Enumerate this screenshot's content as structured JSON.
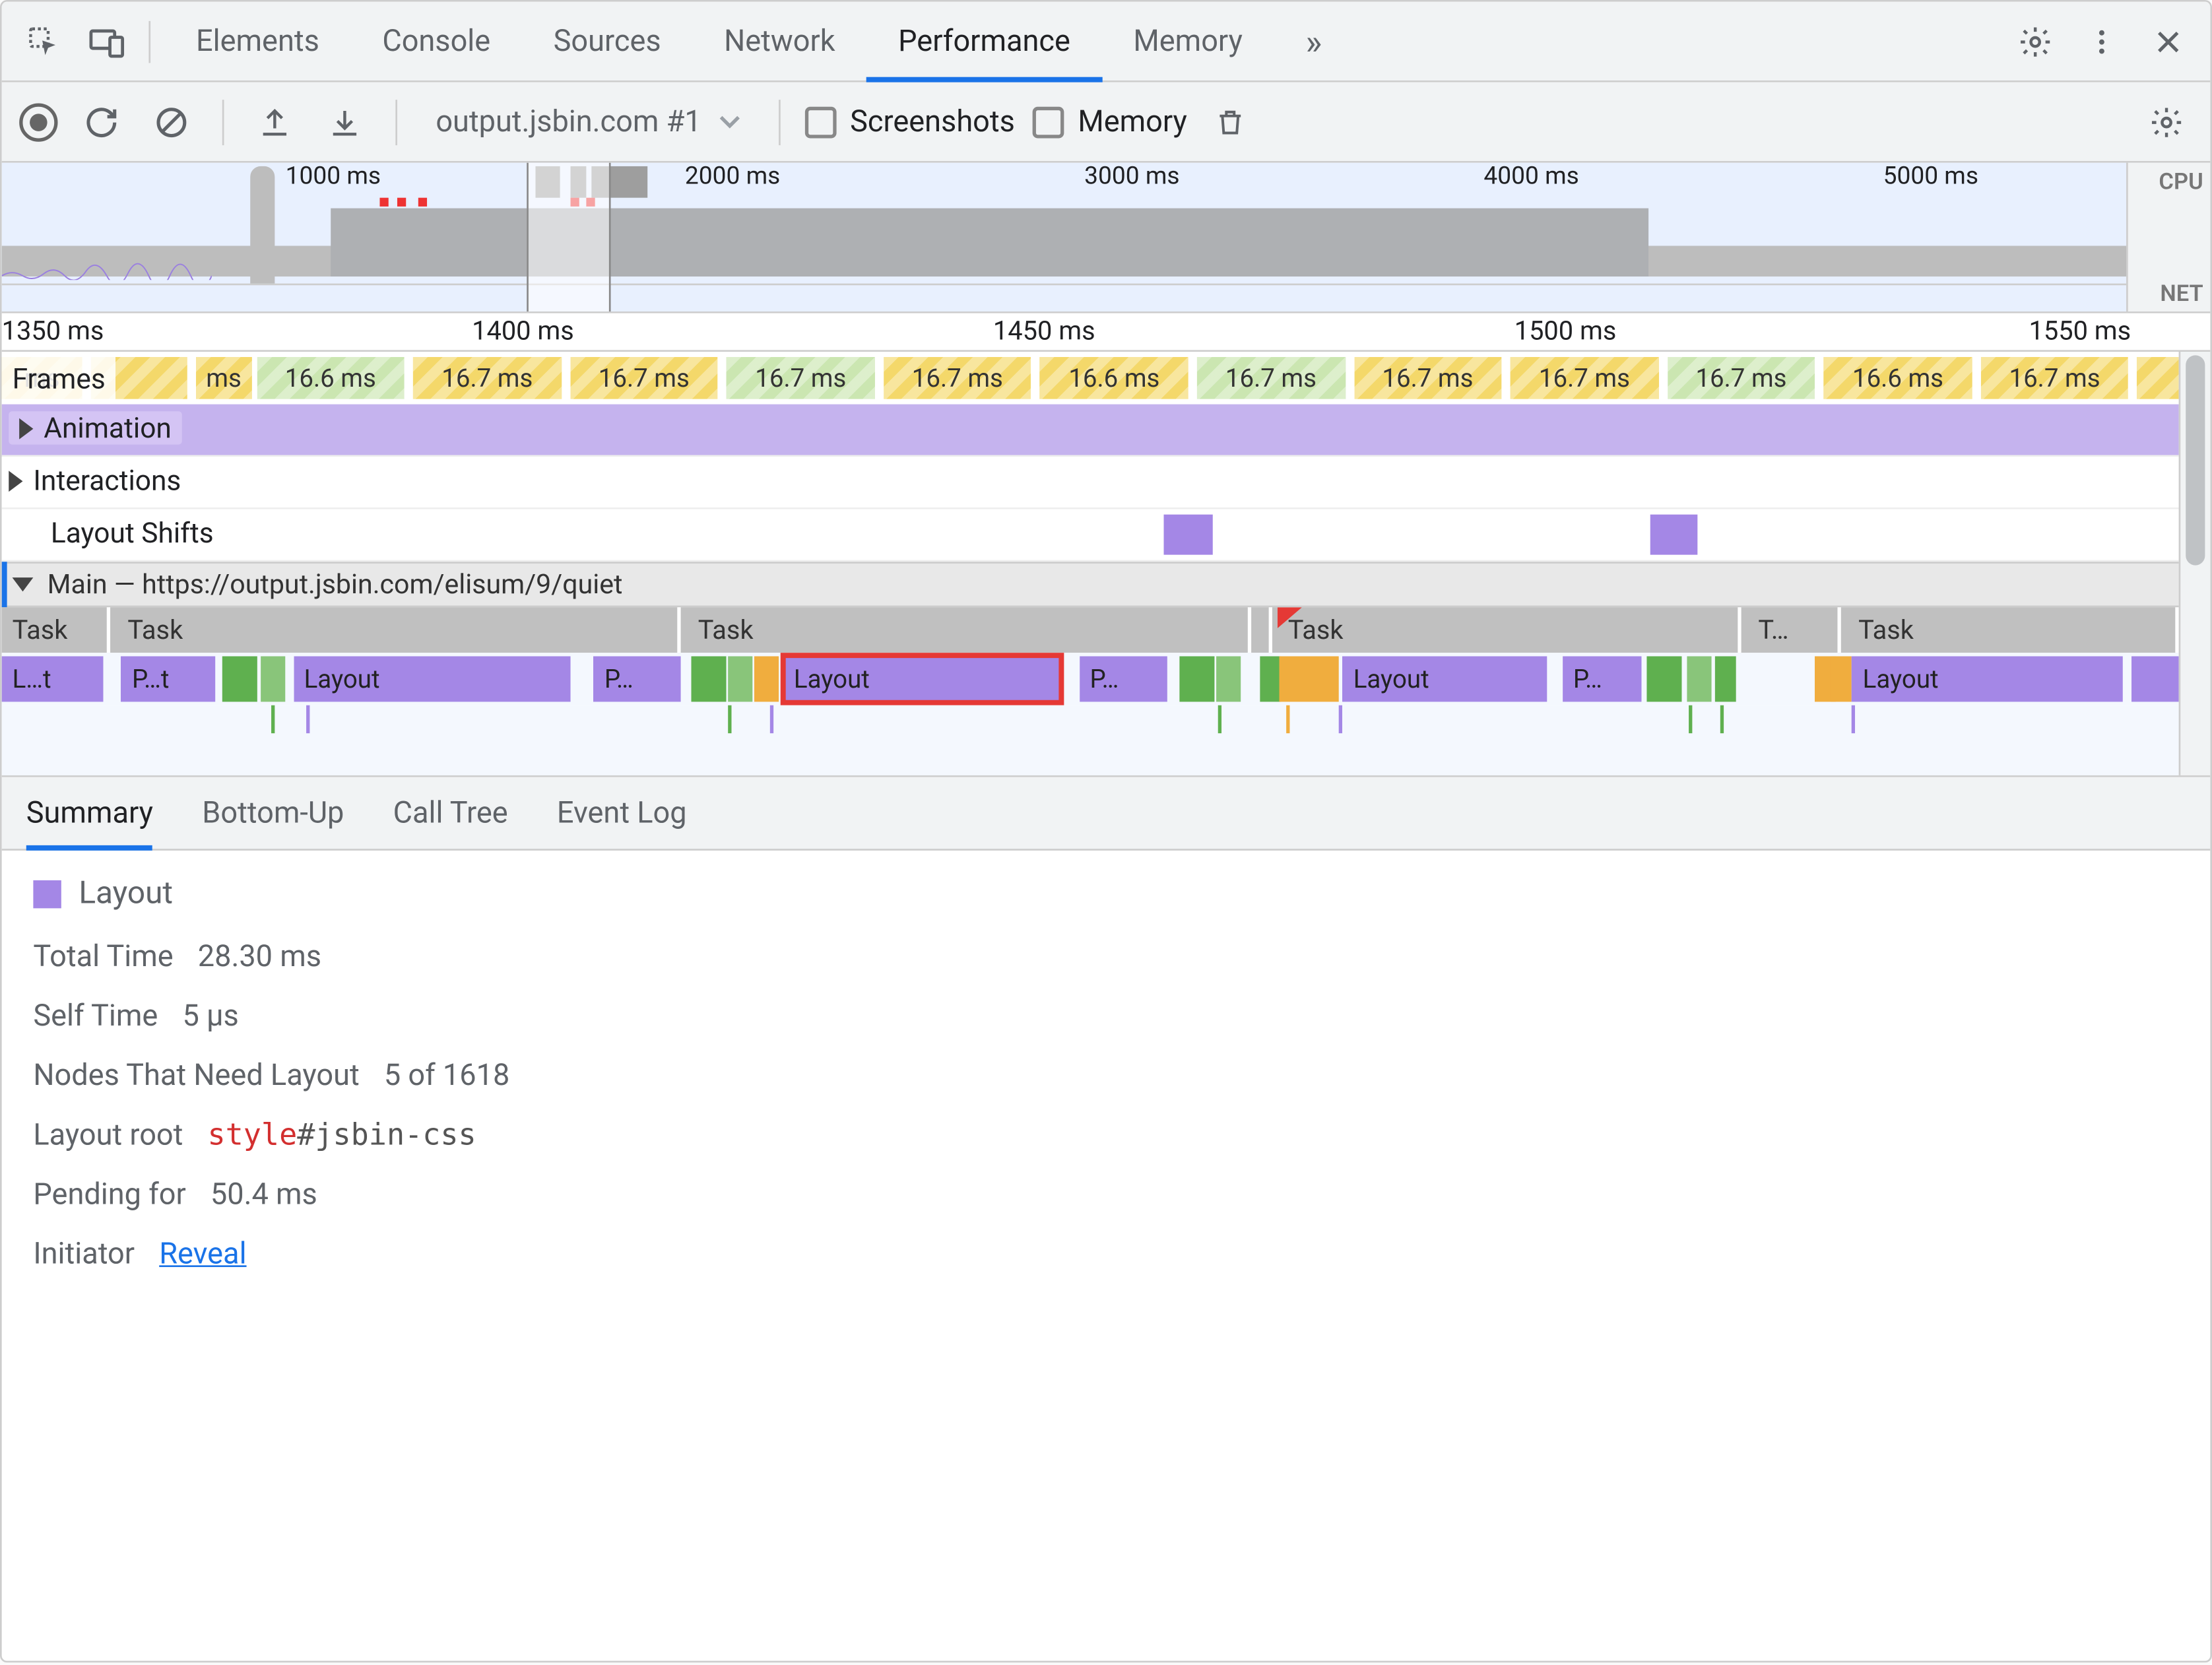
{
  "top_tabs": {
    "items": [
      "Elements",
      "Console",
      "Sources",
      "Network",
      "Performance",
      "Memory"
    ],
    "active_index": 4,
    "overflow_glyph": "»"
  },
  "toolbar": {
    "session_label": "output.jsbin.com #1",
    "screenshots_label": "Screenshots",
    "memory_label": "Memory"
  },
  "overview": {
    "ticks": [
      "1000 ms",
      "2000 ms",
      "3000 ms",
      "4000 ms",
      "5000 ms"
    ],
    "side": {
      "cpu": "CPU",
      "net": "NET"
    },
    "selection_pct": {
      "left": 24.7,
      "width": 4.0
    }
  },
  "detail": {
    "ticks": [
      {
        "label": "1350 ms",
        "pct": 0,
        "align": "left"
      },
      {
        "label": "1400 ms",
        "pct": 23.6
      },
      {
        "label": "1450 ms",
        "pct": 47.2
      },
      {
        "label": "1500 ms",
        "pct": 70.8
      },
      {
        "label": "1550 ms",
        "pct": 94.1
      }
    ]
  },
  "frames": {
    "label": "Frames",
    "cells": [
      {
        "label": "ms",
        "color": "yellow",
        "left": 0,
        "width": 3.7
      },
      {
        "label": "",
        "color": "yellow",
        "left": 4.1,
        "width": 4.4
      },
      {
        "label": "ms",
        "color": "yellow",
        "left": 8.9,
        "width": 2.6
      },
      {
        "label": "16.6 ms",
        "color": "green",
        "left": 11.7,
        "width": 6.8
      },
      {
        "label": "16.7 ms",
        "color": "yellow",
        "left": 18.9,
        "width": 6.8
      },
      {
        "label": "16.7 ms",
        "color": "yellow",
        "left": 26.1,
        "width": 6.8
      },
      {
        "label": "16.7 ms",
        "color": "green",
        "left": 33.3,
        "width": 6.8
      },
      {
        "label": "16.7 ms",
        "color": "yellow",
        "left": 40.5,
        "width": 6.8
      },
      {
        "label": "16.6 ms",
        "color": "yellow",
        "left": 47.7,
        "width": 6.8
      },
      {
        "label": "16.7 ms",
        "color": "green",
        "left": 54.9,
        "width": 6.8
      },
      {
        "label": "16.7 ms",
        "color": "yellow",
        "left": 62.1,
        "width": 6.8
      },
      {
        "label": "16.7 ms",
        "color": "yellow",
        "left": 69.3,
        "width": 6.8
      },
      {
        "label": "16.7 ms",
        "color": "green",
        "left": 76.5,
        "width": 6.8
      },
      {
        "label": "16.6 ms",
        "color": "yellow",
        "left": 83.7,
        "width": 6.8
      },
      {
        "label": "16.7 ms",
        "color": "yellow",
        "left": 90.9,
        "width": 6.8
      },
      {
        "label": "",
        "color": "yellow",
        "left": 98.1,
        "width": 2.2
      }
    ]
  },
  "rows": {
    "animation": "Animation",
    "interactions": "Interactions",
    "layout_shifts": "Layout Shifts",
    "main_prefix": "Main —",
    "main_url": "https://output.jsbin.com/elisum/9/quiet"
  },
  "layout_shift_blocks": [
    {
      "left": 53.4,
      "width": 2.2
    },
    {
      "left": 75.7,
      "width": 2.2
    }
  ],
  "tasks": [
    {
      "label": "Task",
      "left": 0,
      "width": 5.0
    },
    {
      "label": "Task",
      "left": 5.3,
      "width": 25.9
    },
    {
      "label": "Task",
      "left": 31.5,
      "width": 25.9
    },
    {
      "label": "",
      "left": 57.7,
      "width": 0.6
    },
    {
      "label": "Task",
      "left": 58.6,
      "width": 21.3,
      "red": true
    },
    {
      "label": "T…",
      "left": 80.2,
      "width": 4.3
    },
    {
      "label": "Task",
      "left": 84.8,
      "width": 15.2
    }
  ],
  "flame": [
    {
      "label": "L…t",
      "cls": "purple",
      "left": 0,
      "width": 4.7
    },
    {
      "label": "P…t",
      "cls": "purple",
      "left": 5.5,
      "width": 4.3
    },
    {
      "label": "",
      "cls": "green",
      "left": 10.1,
      "width": 1.6
    },
    {
      "label": "",
      "cls": "green2",
      "left": 11.9,
      "width": 1.1
    },
    {
      "label": "Layout",
      "cls": "purple",
      "left": 13.4,
      "width": 12.7
    },
    {
      "label": "P…",
      "cls": "purple",
      "left": 27.2,
      "width": 4.0
    },
    {
      "label": "",
      "cls": "green",
      "left": 31.7,
      "width": 1.6
    },
    {
      "label": "",
      "cls": "green2",
      "left": 33.4,
      "width": 1.1
    },
    {
      "label": "",
      "cls": "orange",
      "left": 34.6,
      "width": 1.1
    },
    {
      "label": "Layout",
      "cls": "purple outline",
      "left": 35.9,
      "width": 12.7
    },
    {
      "label": "P…",
      "cls": "purple",
      "left": 49.5,
      "width": 4.0
    },
    {
      "label": "",
      "cls": "green",
      "left": 54.1,
      "width": 1.6
    },
    {
      "label": "",
      "cls": "green2",
      "left": 55.8,
      "width": 1.1
    },
    {
      "label": "",
      "cls": "green",
      "left": 57.8,
      "width": 0.5
    },
    {
      "label": "",
      "cls": "orange",
      "left": 58.7,
      "width": 2.7
    },
    {
      "label": "Layout",
      "cls": "purple",
      "left": 61.6,
      "width": 9.4
    },
    {
      "label": "P…",
      "cls": "purple",
      "left": 71.7,
      "width": 3.6
    },
    {
      "label": "",
      "cls": "green",
      "left": 75.6,
      "width": 1.6
    },
    {
      "label": "",
      "cls": "green2",
      "left": 77.4,
      "width": 1.1
    },
    {
      "label": "",
      "cls": "green",
      "left": 78.7,
      "width": 1.0
    },
    {
      "label": "",
      "cls": "orange",
      "left": 83.3,
      "width": 0.5
    },
    {
      "label": "",
      "cls": "orange",
      "left": 84.0,
      "width": 0.5
    },
    {
      "label": "Layout",
      "cls": "purple",
      "left": 85.0,
      "width": 12.4
    },
    {
      "label": "",
      "cls": "purple",
      "left": 97.8,
      "width": 2.2
    }
  ],
  "flame_ticks": [
    {
      "cls": "green",
      "left": 12.4
    },
    {
      "cls": "purple",
      "left": 14.0
    },
    {
      "cls": "green",
      "left": 33.4
    },
    {
      "cls": "purple",
      "left": 35.3
    },
    {
      "cls": "green",
      "left": 55.9
    },
    {
      "cls": "orange",
      "left": 59.0
    },
    {
      "cls": "purple",
      "left": 61.4
    },
    {
      "cls": "green",
      "left": 77.5
    },
    {
      "cls": "green",
      "left": 78.9
    },
    {
      "cls": "purple",
      "left": 85.0
    }
  ],
  "bottom_tabs": {
    "items": [
      "Summary",
      "Bottom-Up",
      "Call Tree",
      "Event Log"
    ],
    "active_index": 0
  },
  "summary": {
    "title": "Layout",
    "rows": [
      {
        "k": "Total Time",
        "v": "28.30 ms"
      },
      {
        "k": "Self Time",
        "v": "5 µs"
      },
      {
        "k": "Nodes That Need Layout",
        "v": "5 of 1618"
      },
      {
        "k": "Layout root",
        "type": "code",
        "tag": "style",
        "id": "#jsbin-css"
      },
      {
        "k": "Pending for",
        "v": "50.4 ms"
      },
      {
        "k": "Initiator",
        "type": "link",
        "v": "Reveal"
      }
    ]
  }
}
